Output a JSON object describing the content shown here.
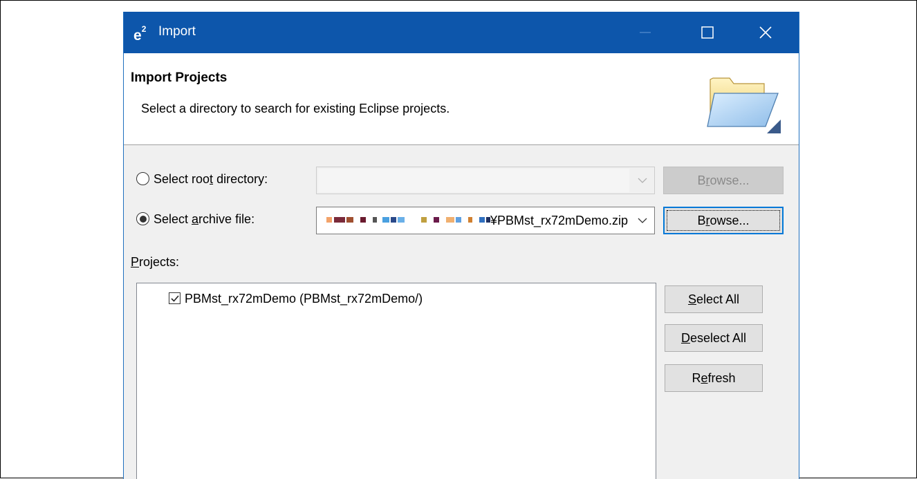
{
  "window": {
    "app_icon_label": "e",
    "app_icon_sup": "2",
    "title": "Import"
  },
  "header": {
    "title": "Import Projects",
    "description": "Select a directory to search for existing Eclipse projects."
  },
  "root_directory": {
    "label_before": "Select roo",
    "label_mnemonic": "t",
    "label_after": " directory:",
    "selected": false,
    "value": "",
    "browse_label_before": "B",
    "browse_label_mnemonic": "r",
    "browse_label_after": "owse...",
    "enabled": false
  },
  "archive_file": {
    "label_before": "Select ",
    "label_mnemonic": "a",
    "label_after": "rchive file:",
    "selected": true,
    "value_visible_suffix": "¥PBMst_rx72mDemo.zip",
    "browse_label_before": "B",
    "browse_label_mnemonic": "r",
    "browse_label_after": "owse...",
    "enabled": true
  },
  "projects": {
    "label_mnemonic": "P",
    "label_after": "rojects:",
    "items": [
      {
        "label": "PBMst_rx72mDemo (PBMst_rx72mDemo/)",
        "checked": true
      }
    ]
  },
  "buttons": {
    "select_all_mnemonic": "S",
    "select_all_after": "elect All",
    "deselect_all_mnemonic": "D",
    "deselect_all_after": "eselect All",
    "refresh_before": "R",
    "refresh_mnemonic": "e",
    "refresh_after": "fresh"
  },
  "colors": {
    "titlebar": "#0d56ab",
    "focus_border": "#0078d7"
  }
}
